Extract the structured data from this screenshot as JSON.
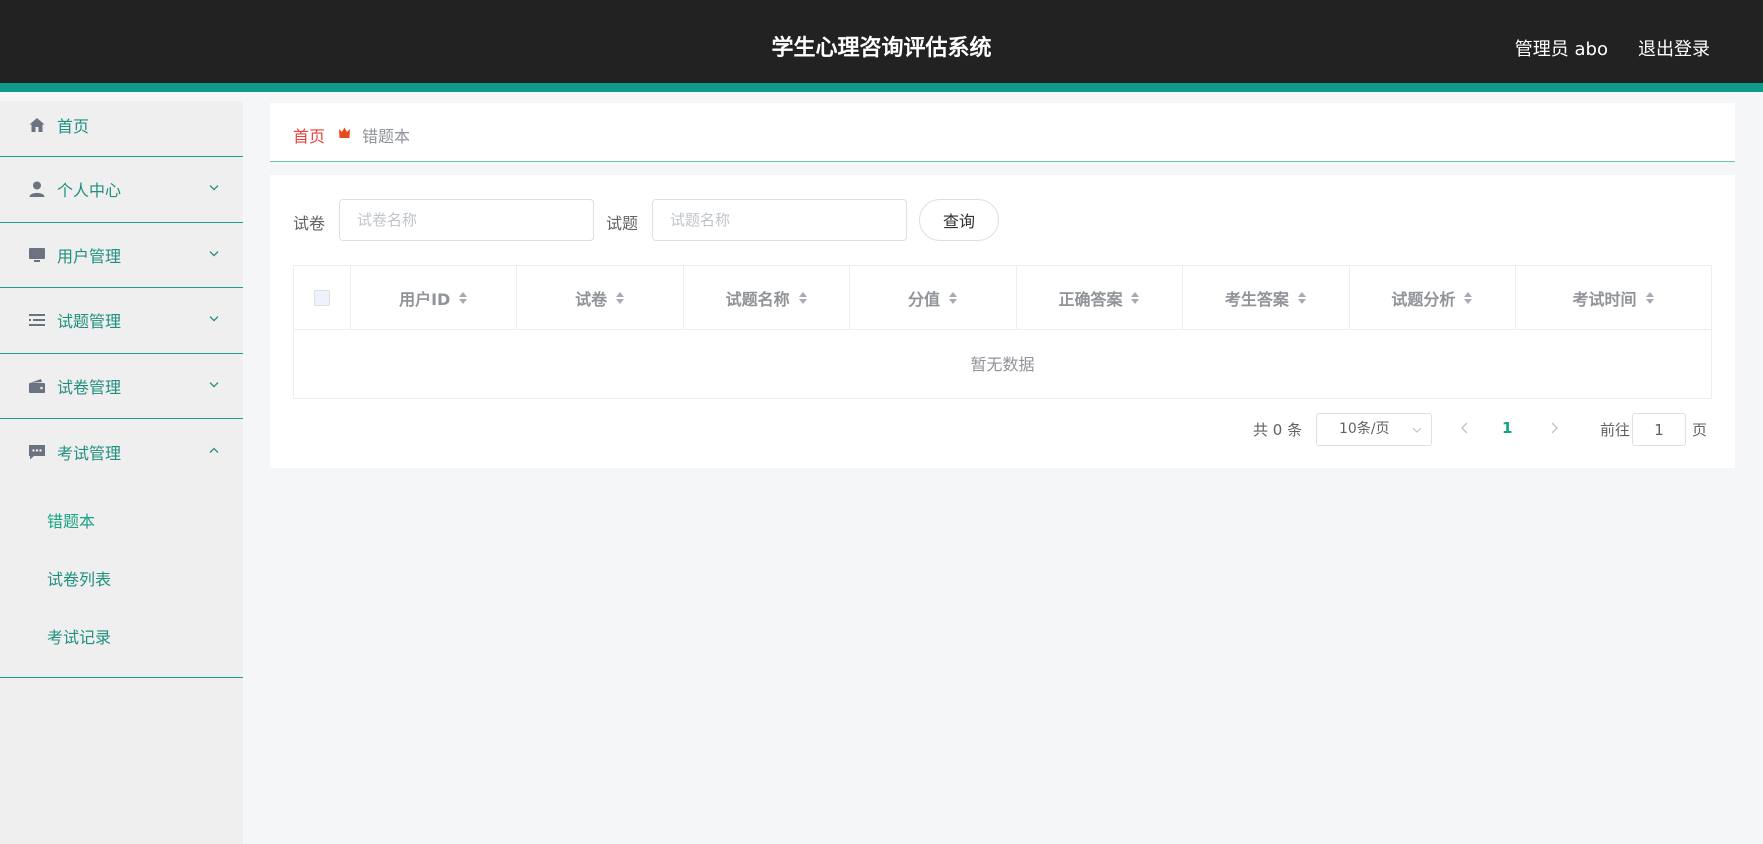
{
  "header": {
    "title": "学生心理咨询评估系统",
    "user": "管理员 abo",
    "logout": "退出登录"
  },
  "sidebar": {
    "items": [
      {
        "label": "首页",
        "icon": "home-icon"
      },
      {
        "label": "个人中心",
        "icon": "user-icon",
        "expanded": false
      },
      {
        "label": "用户管理",
        "icon": "monitor-icon",
        "expanded": false
      },
      {
        "label": "试题管理",
        "icon": "list-icon",
        "expanded": false
      },
      {
        "label": "试卷管理",
        "icon": "wallet-icon",
        "expanded": false
      },
      {
        "label": "考试管理",
        "icon": "chat-icon",
        "expanded": true
      }
    ],
    "submenu": [
      {
        "label": "错题本",
        "active": true
      },
      {
        "label": "试卷列表",
        "active": false
      },
      {
        "label": "考试记录",
        "active": false
      }
    ]
  },
  "breadcrumb": {
    "home": "首页",
    "current": "错题本"
  },
  "search": {
    "paper_label": "试卷",
    "paper_placeholder": "试卷名称",
    "question_label": "试题",
    "question_placeholder": "试题名称",
    "query_button": "查询"
  },
  "table": {
    "columns": [
      "用户ID",
      "试卷",
      "试题名称",
      "分值",
      "正确答案",
      "考生答案",
      "试题分析",
      "考试时间"
    ],
    "empty_text": "暂无数据"
  },
  "pagination": {
    "total": "共 0 条",
    "page_size": "10条/页",
    "current_page": "1",
    "goto_label": "前往",
    "goto_value": "1",
    "page_suffix": "页"
  },
  "colors": {
    "header_bg": "#222222",
    "accent": "#0f9a8a",
    "sidebar_bg": "#efefef",
    "menu_text": "#1f8f7f",
    "breadcrumb_home": "#e8423a",
    "active_page": "#16a584"
  }
}
